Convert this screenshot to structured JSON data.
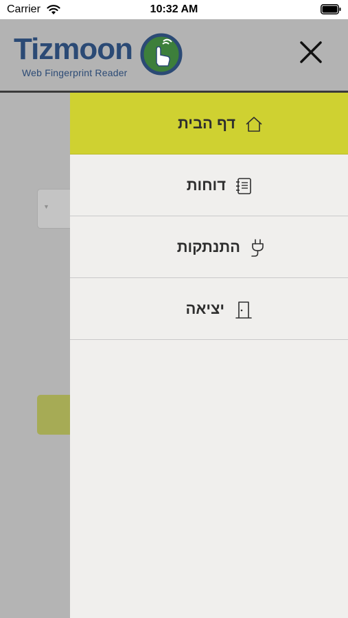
{
  "status_bar": {
    "carrier": "Carrier",
    "time": "10:32 AM",
    "icons": [
      "wifi-icon",
      "battery-icon"
    ]
  },
  "header": {
    "logo_text": "Tizmoon",
    "logo_subtitle": "Web Fingerprint Reader",
    "close_icon": "close-icon"
  },
  "menu": {
    "items": [
      {
        "label": "דף הבית",
        "icon": "home-icon",
        "active": true
      },
      {
        "label": "דוחות",
        "icon": "reports-icon",
        "active": false
      },
      {
        "label": "התנתקות",
        "icon": "plug-icon",
        "active": false
      },
      {
        "label": "יציאה",
        "icon": "door-icon",
        "active": false
      }
    ]
  },
  "colors": {
    "header_bg": "#b3b3b3",
    "menu_bg": "#f0efed",
    "active_item_bg": "#cfd131",
    "brand_blue": "#2b4a75",
    "brand_green": "#3d7f3b"
  }
}
